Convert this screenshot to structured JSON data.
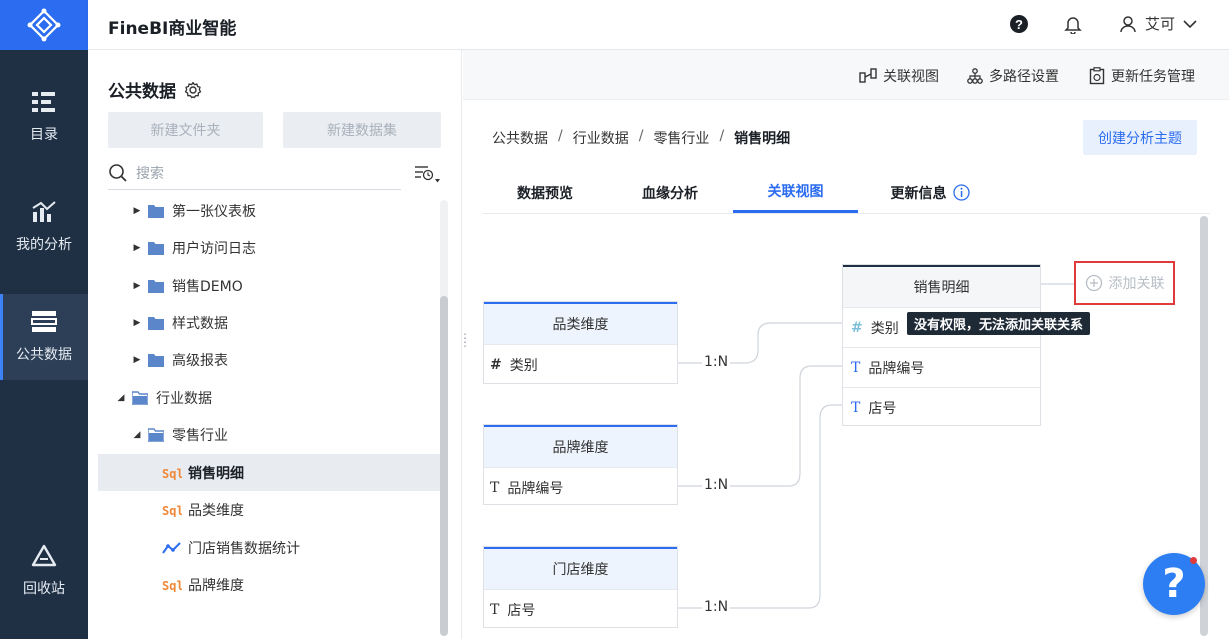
{
  "app": {
    "title": "FineBI商业智能"
  },
  "nav": {
    "items": [
      {
        "label": "目录",
        "icon": "catalog-icon"
      },
      {
        "label": "我的分析",
        "icon": "analysis-icon"
      },
      {
        "label": "公共数据",
        "icon": "public-data-icon",
        "active": true
      },
      {
        "label": "回收站",
        "icon": "recycle-bin-icon"
      }
    ]
  },
  "header": {
    "user_name": "艾可"
  },
  "panel": {
    "title": "公共数据",
    "new_folder": "新建文件夹",
    "new_dataset": "新建数据集",
    "search_placeholder": "搜索",
    "tree": [
      {
        "label": "第一张仪表板",
        "type": "folder",
        "expanded": false
      },
      {
        "label": "用户访问日志",
        "type": "folder",
        "expanded": false
      },
      {
        "label": "销售DEMO",
        "type": "folder",
        "expanded": false
      },
      {
        "label": "样式数据",
        "type": "folder",
        "expanded": false
      },
      {
        "label": "高级报表",
        "type": "folder",
        "expanded": false
      },
      {
        "label": "行业数据",
        "type": "folder",
        "expanded": true
      },
      {
        "label": "零售行业",
        "type": "folder",
        "expanded": true
      },
      {
        "label": "销售明细",
        "type": "sql",
        "selected": true
      },
      {
        "label": "品类维度",
        "type": "sql"
      },
      {
        "label": "门店销售数据统计",
        "type": "analysis"
      },
      {
        "label": "品牌维度",
        "type": "sql"
      }
    ]
  },
  "toolbar": {
    "relation_view": "关联视图",
    "multi_path": "多路径设置",
    "update_task": "更新任务管理"
  },
  "breadcrumb": [
    "公共数据",
    "行业数据",
    "零售行业",
    "销售明细"
  ],
  "create_topic": "创建分析主题",
  "tabs": [
    "数据预览",
    "血缘分析",
    "关联视图",
    "更新信息"
  ],
  "active_tab": "关联视图",
  "diagram": {
    "main_table": {
      "name": "销售明细",
      "fields": [
        {
          "name": "类别",
          "type": "number"
        },
        {
          "name": "品牌编号",
          "type": "text"
        },
        {
          "name": "店号",
          "type": "text"
        }
      ]
    },
    "dimension_tables": [
      {
        "name": "品类维度",
        "field": "类别",
        "field_type": "number",
        "relation": "1:N"
      },
      {
        "name": "品牌维度",
        "field": "品牌编号",
        "field_type": "text",
        "relation": "1:N"
      },
      {
        "name": "门店维度",
        "field": "店号",
        "field_type": "text",
        "relation": "1:N"
      }
    ],
    "add_relation": "添加关联",
    "tooltip": "没有权限，无法添加关联关系"
  },
  "help_label": "?",
  "colors": {
    "accent": "#2c6cf0",
    "nav_bg": "#1f3044",
    "highlight": "#e03b3b"
  }
}
